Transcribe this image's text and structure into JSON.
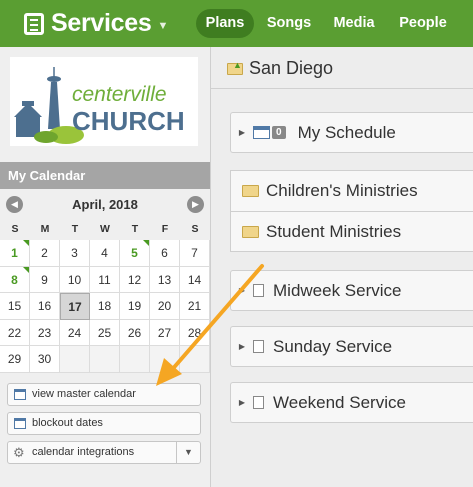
{
  "app": {
    "title": "Services",
    "tabs": [
      {
        "label": "Plans",
        "active": true
      },
      {
        "label": "Songs",
        "active": false
      },
      {
        "label": "Media",
        "active": false
      },
      {
        "label": "People",
        "active": false
      }
    ]
  },
  "logo": {
    "line1": "centerville",
    "line2": "CHURCH"
  },
  "calendar": {
    "header": "My Calendar",
    "month": "April, 2018",
    "weekdays": [
      "S",
      "M",
      "T",
      "W",
      "T",
      "F",
      "S"
    ],
    "weeks": [
      [
        "1",
        "2",
        "3",
        "4",
        "5",
        "6",
        "7"
      ],
      [
        "8",
        "9",
        "10",
        "11",
        "12",
        "13",
        "14"
      ],
      [
        "15",
        "16",
        "17",
        "18",
        "19",
        "20",
        "21"
      ],
      [
        "22",
        "23",
        "24",
        "25",
        "26",
        "27",
        "28"
      ],
      [
        "29",
        "30",
        "",
        "",
        "",
        "",
        ""
      ]
    ],
    "event_days": [
      "1",
      "5",
      "8"
    ],
    "today": "17"
  },
  "sidebar_buttons": {
    "master_calendar": "view master calendar",
    "blockout": "blockout dates",
    "integrations": "calendar integrations"
  },
  "main": {
    "breadcrumb": "San Diego",
    "my_schedule": {
      "label": "My Schedule",
      "count": "0"
    },
    "folders": [
      "Children's Ministries",
      "Student Ministries"
    ],
    "services": [
      "Midweek Service",
      "Sunday Service",
      "Weekend Service"
    ]
  },
  "colors": {
    "brand_green": "#5a9e32",
    "active_tab": "#3f7d20",
    "annotation": "#f5a623"
  }
}
